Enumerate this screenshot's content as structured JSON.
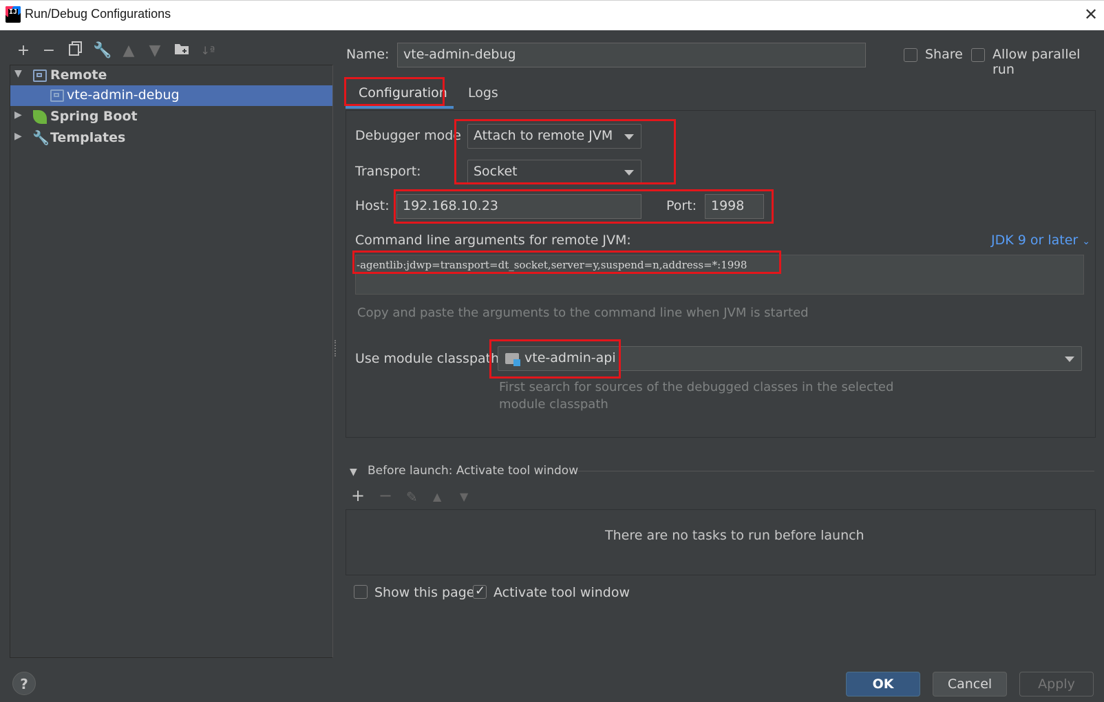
{
  "window": {
    "title": "Run/Debug Configurations"
  },
  "tree": {
    "items": [
      {
        "label": "Remote",
        "level": 0,
        "expanded": true
      },
      {
        "label": "vte-admin-debug",
        "level": 1,
        "selected": true
      },
      {
        "label": "Spring Boot",
        "level": 0,
        "expanded": false
      },
      {
        "label": "Templates",
        "level": 0,
        "expanded": false
      }
    ]
  },
  "toolbar": {
    "icons": [
      "plus-icon",
      "minus-icon",
      "copy-icon",
      "wrench-icon",
      "arrow-up-icon",
      "arrow-down-icon",
      "new-folder-icon",
      "sort-icon"
    ]
  },
  "form": {
    "name_label": "Name:",
    "name_value": "vte-admin-debug",
    "share_label": "Share",
    "share_checked": false,
    "parallel_label": "Allow parallel run",
    "parallel_checked": false,
    "tabs": [
      {
        "label": "Configuration",
        "active": true
      },
      {
        "label": "Logs",
        "active": false
      }
    ],
    "debugger_mode_label": "Debugger mode",
    "debugger_mode_value": "Attach to remote JVM",
    "transport_label": "Transport:",
    "transport_value": "Socket",
    "host_label": "Host:",
    "host_value": "192.168.10.23",
    "port_label": "Port:",
    "port_value": "1998",
    "cmd_label": "Command line arguments for remote JVM:",
    "jdk_link": "JDK 9 or later",
    "cmd_value": "-agentlib:jdwp=transport=dt_socket,server=y,suspend=n,address=*:1998",
    "cmd_hint": "Copy and paste the arguments to the command line when JVM is started",
    "classpath_label": "Use module classpath:",
    "classpath_value": "vte-admin-api",
    "classpath_hint_1": "First search for sources of the debugged classes in the selected",
    "classpath_hint_2": "module classpath"
  },
  "before_launch": {
    "title": "Before launch: Activate tool window",
    "empty_text": "There are no tasks to run before launch",
    "show_page_label": "Show this page",
    "show_page_checked": false,
    "activate_label": "Activate tool window",
    "activate_checked": true
  },
  "buttons": {
    "ok": "OK",
    "cancel": "Cancel",
    "apply": "Apply"
  },
  "help": {
    "label": "?"
  },
  "colors": {
    "accent": "#4b6eaf",
    "highlight": "#e3161b",
    "link": "#589df6",
    "background": "#3c3f41"
  }
}
